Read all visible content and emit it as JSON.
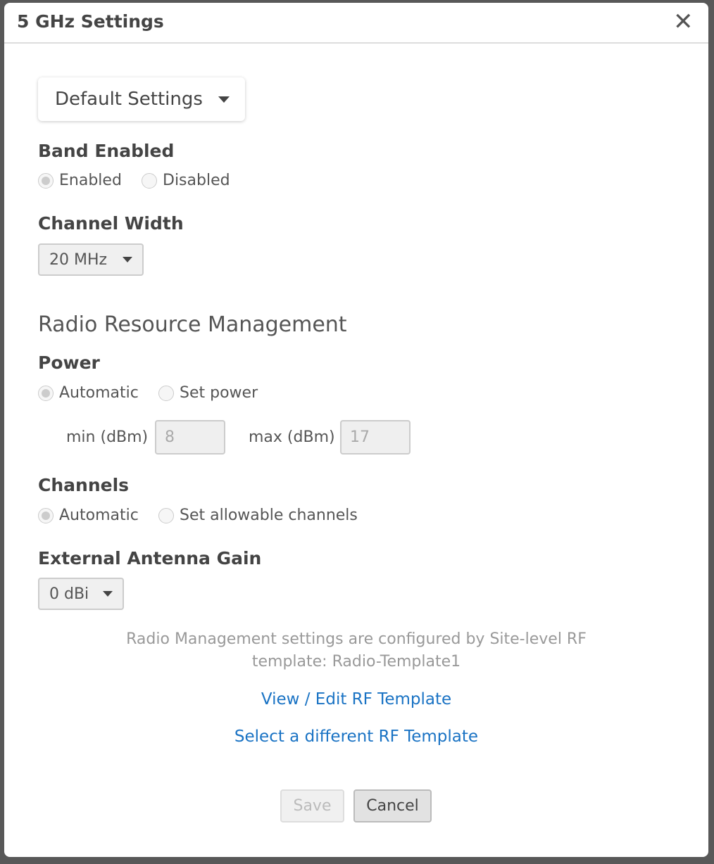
{
  "dialog": {
    "title": "5 GHz Settings",
    "close_icon": "close-icon"
  },
  "preset": {
    "selected": "Default Settings"
  },
  "band_enabled": {
    "heading": "Band Enabled",
    "options": [
      "Enabled",
      "Disabled"
    ],
    "selected": "Enabled"
  },
  "channel_width": {
    "heading": "Channel Width",
    "selected": "20 MHz"
  },
  "rrm": {
    "heading": "Radio Resource Management",
    "power": {
      "heading": "Power",
      "options": [
        "Automatic",
        "Set power"
      ],
      "selected": "Automatic",
      "min_label": "min (dBm)",
      "min_value": "8",
      "max_label": "max (dBm)",
      "max_value": "17"
    },
    "channels": {
      "heading": "Channels",
      "options": [
        "Automatic",
        "Set allowable channels"
      ],
      "selected": "Automatic"
    },
    "antenna": {
      "heading": "External Antenna Gain",
      "selected": "0 dBi"
    }
  },
  "note": {
    "line1": "Radio Management settings are configured by Site-level RF",
    "line2": "template: Radio-Template1"
  },
  "links": {
    "view_edit": "View / Edit RF Template",
    "select_different": "Select a different RF Template"
  },
  "footer": {
    "save": "Save",
    "cancel": "Cancel"
  }
}
